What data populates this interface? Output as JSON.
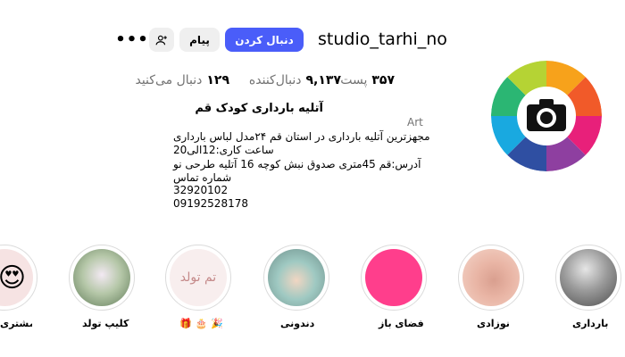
{
  "profile": {
    "username": "studio_tarhi_no",
    "follow_label": "دنبال کردن",
    "message_label": "پیام",
    "more_label": "•••"
  },
  "stats": {
    "posts_value": "۳۵۷",
    "posts_label": "پست",
    "followers_value": "۹,۱۳۷",
    "followers_label": "دنبال‌کننده",
    "following_value": "۱۲۹",
    "following_label": "دنبال می‌کنید"
  },
  "bio": {
    "name": "آتلیه بارداری کودک قم",
    "category": "Art",
    "lines": [
      "مجهزترین آتلیه بارداری در استان قم ۲۴مدل لباس بارداری",
      "ساعت کاری:12الی20",
      "آدرس:قم 45متری صدوق نبش کوچه 16 آتلیه طرحی نو",
      "شماره تماس",
      "32920102",
      "09192528178"
    ]
  },
  "highlights": [
    {
      "label": "بارداری"
    },
    {
      "label": "نوزادی"
    },
    {
      "label": "فضای باز"
    },
    {
      "label": "دندونی"
    },
    {
      "label": "🎉 🎂 🎁",
      "cover_text": "تم تولد"
    },
    {
      "label": "کلیپ تولد"
    },
    {
      "label": "رضایت مشتری",
      "cover_emoji": "😍"
    }
  ],
  "colors": {
    "follow_button": "#4a5df9",
    "secondary_button": "#efefef",
    "muted_text": "#737373"
  }
}
